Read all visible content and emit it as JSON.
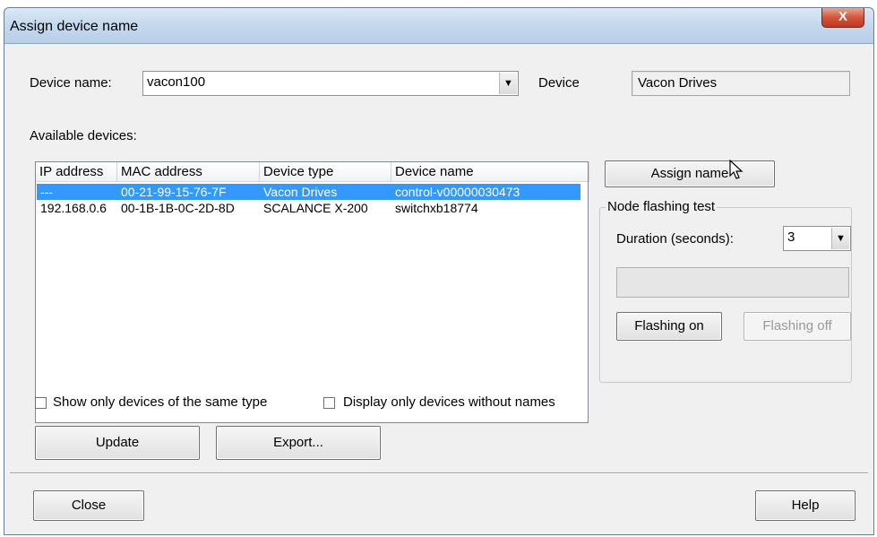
{
  "window": {
    "title": "Assign device name",
    "close_glyph": "X",
    "top_caption": ""
  },
  "device_name": {
    "label": "Device name:",
    "value": "vacon100"
  },
  "device": {
    "label": "Device",
    "value": "Vacon Drives"
  },
  "available_devices": {
    "label": "Available devices:",
    "columns": [
      "IP address",
      "MAC address",
      "Device type",
      "Device name"
    ],
    "rows": [
      {
        "ip": "---",
        "mac": "00-21-99-15-76-7F",
        "type": "Vacon Drives",
        "name": "control-v00000030473",
        "selected": true
      },
      {
        "ip": "192.168.0.6",
        "mac": "00-1B-1B-0C-2D-8D",
        "type": "SCALANCE X-200",
        "name": "switchxb18774",
        "selected": false
      }
    ]
  },
  "assign_name_button": "Assign name",
  "node_flashing": {
    "legend": "Node flashing test",
    "duration_label": "Duration (seconds):",
    "duration_value": "3",
    "flashing_on": "Flashing on",
    "flashing_off": "Flashing off"
  },
  "filters": {
    "same_type_label": "Show only devices of the same type",
    "without_names_label": "Display only devices without names",
    "same_type_checked": false,
    "without_names_checked": false
  },
  "buttons": {
    "update": "Update",
    "export": "Export...",
    "close": "Close",
    "help": "Help"
  },
  "icons": {
    "dropdown": "chevron-down-icon",
    "cursor": "mouse-pointer-icon",
    "close": "close-icon"
  },
  "colors": {
    "selection": "#3399ff",
    "title_gradient_top": "#dce9f6",
    "close_button": "#c0381f"
  }
}
